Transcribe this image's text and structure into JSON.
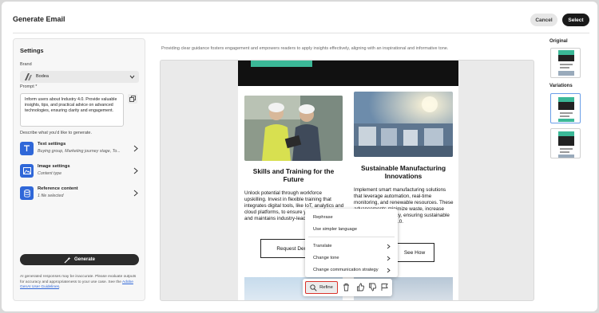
{
  "header": {
    "title": "Generate Email",
    "cancel_label": "Cancel",
    "select_label": "Select"
  },
  "settings": {
    "title": "Settings",
    "brand_label": "Brand",
    "brand_value": "Bodea",
    "prompt_label": "Prompt",
    "prompt_required": "*",
    "prompt_text": "Inform users about Industry 4.0. Provide valuable insights, tips, and practical advice on advanced technologies, ensuring clarity and engagement.",
    "describe_label": "Describe what you'd like to generate.",
    "options": [
      {
        "title": "Text settings",
        "subtitle": "Buying group, Marketing journey stage, To...",
        "icon": "text-icon"
      },
      {
        "title": "Image settings",
        "subtitle": "Content type",
        "icon": "image-icon"
      },
      {
        "title": "Reference content",
        "subtitle": "1 file selected",
        "icon": "database-icon"
      }
    ],
    "generate_label": "Generate",
    "disclaimer_text": "AI generated responses may be inaccurate. Please evaluate outputs for accuracy and appropriateness to your use case. See the",
    "disclaimer_link": "Adobe GenAI User Guidelines",
    "disclaimer_end": "."
  },
  "preview": {
    "caption": "Providing clear guidance fosters engagement and empowers readers to apply insights effectively, aligning with an inspirational and informative tone.",
    "card1": {
      "heading": "Skills and Training for the Future",
      "body": "Unlock potential through workforce upskilling. Invest in flexible training that integrates digital tools, like IoT, analytics and cloud platforms, to ensure your team adapts and maintains industry-leading...",
      "button": "Request Demo"
    },
    "card2": {
      "heading": "Sustainable Manufacturing Innovations",
      "body": "Implement smart manufacturing solutions that leverage automation, real-time monitoring, and renewable resources. These advancements minimize waste, increase operational efficiency, ensuring sustainable growth in Industry 4.0.",
      "button": "See How"
    }
  },
  "context_menu": {
    "items": [
      "Rephrase",
      "Use simpler language",
      "Translate",
      "Change tone",
      "Change communication strategy"
    ]
  },
  "toolbar": {
    "refine_label": "Refine"
  },
  "right_panel": {
    "original_label": "Original",
    "variations_label": "Variations"
  },
  "colors": {
    "accent_blue": "#2f67d8",
    "teal": "#3bb897",
    "highlight_red": "#d9322b"
  }
}
